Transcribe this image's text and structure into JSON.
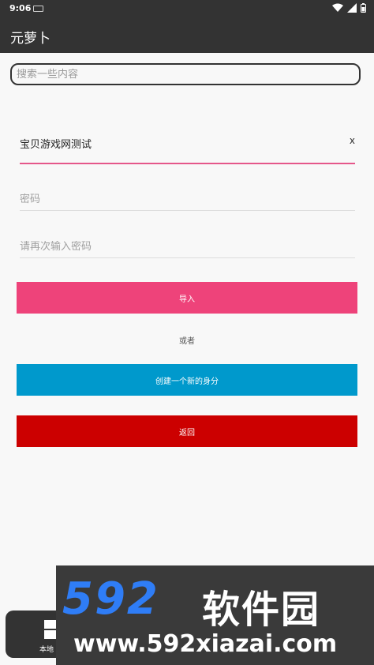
{
  "status_bar": {
    "time": "9:06",
    "icons": [
      "keyboard-icon",
      "wifi-icon",
      "signal-icon",
      "battery-icon"
    ]
  },
  "app_bar": {
    "title": "元萝卜"
  },
  "search": {
    "placeholder": "搜索一些内容"
  },
  "form": {
    "name_value": "宝贝游戏网测试",
    "clear_label": "x",
    "password_placeholder": "密码",
    "confirm_password_placeholder": "请再次输入密码"
  },
  "buttons": {
    "import_label": "导入",
    "or_text": "或者",
    "create_label": "创建一个新的身分",
    "back_label": "返回"
  },
  "bottom_tab": {
    "label": "本地",
    "icon": "grid-icon"
  },
  "watermark": {
    "number": "592",
    "name": "软件园",
    "url": "www.592xiazai.com"
  },
  "colors": {
    "app_bar": "#333333",
    "accent_pink": "#ee437a",
    "underline_pink": "#e5578a",
    "create_blue": "#0099cc",
    "back_red": "#cc0000",
    "background": "#f8f8f8"
  }
}
